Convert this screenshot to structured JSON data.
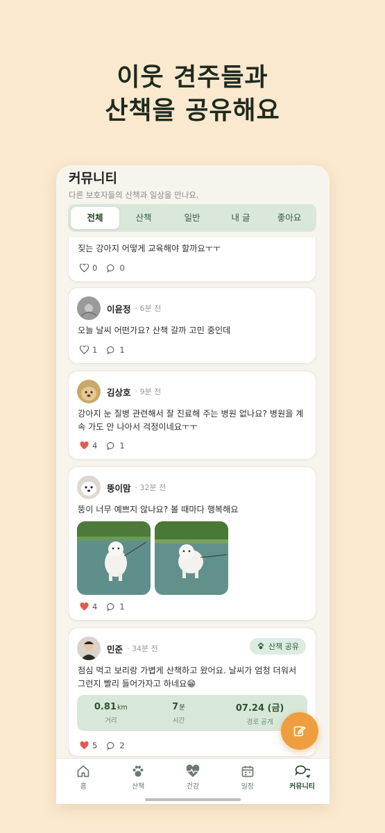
{
  "hero": {
    "line1": "이웃 견주들과",
    "line2": "산책을 공유해요"
  },
  "header": {
    "title": "커뮤니티",
    "subtitle": "다른 보호자들의 산책과 일상을 만나요."
  },
  "tabs": [
    {
      "label": "전체",
      "active": true
    },
    {
      "label": "산책",
      "active": false
    },
    {
      "label": "일반",
      "active": false
    },
    {
      "label": "내 글",
      "active": false
    },
    {
      "label": "좋아요",
      "active": false
    }
  ],
  "posts": [
    {
      "text": "짖는 강아지 어떻게 교육해야 할까요ㅜㅜ",
      "likes": "0",
      "comments": "0",
      "liked": false
    },
    {
      "author": "이윤정",
      "time": "· 6분 전",
      "text": "오늘 날씨 어떤가요? 산책 갈까 고민 중인데",
      "likes": "1",
      "comments": "1",
      "liked": false
    },
    {
      "author": "김상호",
      "time": "· 9분 전",
      "text": "강아지 눈 질병 관련해서 잘 진료해 주는 병원 없나요? 병원을 계속 가도 안 나아서 걱정이네요ㅜㅜ",
      "likes": "4",
      "comments": "1",
      "liked": true
    },
    {
      "author": "뚱이맘",
      "time": "· 32분 전",
      "text": "뚱이 너무 예쁘지 않나요? 볼 때마다 행복해요",
      "likes": "4",
      "comments": "1",
      "liked": true
    },
    {
      "author": "민준",
      "time": "· 34분 전",
      "badge": "산책 공유",
      "text": "점심 먹고 보리랑 가볍게 산책하고 왔어요. 날씨가 엄청 더워서 그런지 빨리 들어가자고 하네요😁",
      "likes": "5",
      "comments": "2",
      "liked": true,
      "walk": {
        "distance": "0.81",
        "distance_unit": "km",
        "distance_label": "거리",
        "time": "7",
        "time_unit": "분",
        "time_label": "시간",
        "date": "07.24 (금)",
        "date_label": "경로 공개"
      }
    }
  ],
  "nav": [
    {
      "label": "홈",
      "icon": "home-icon"
    },
    {
      "label": "산책",
      "icon": "paw-icon"
    },
    {
      "label": "건강",
      "icon": "heart-pulse-icon"
    },
    {
      "label": "일정",
      "icon": "calendar-icon"
    },
    {
      "label": "커뮤니티",
      "icon": "chat-icon",
      "active": true
    }
  ],
  "colors": {
    "background": "#fbe9cf",
    "accent_green": "#d8e8d8",
    "fab_orange": "#ee9e3e",
    "like_red": "#e05a4f"
  }
}
